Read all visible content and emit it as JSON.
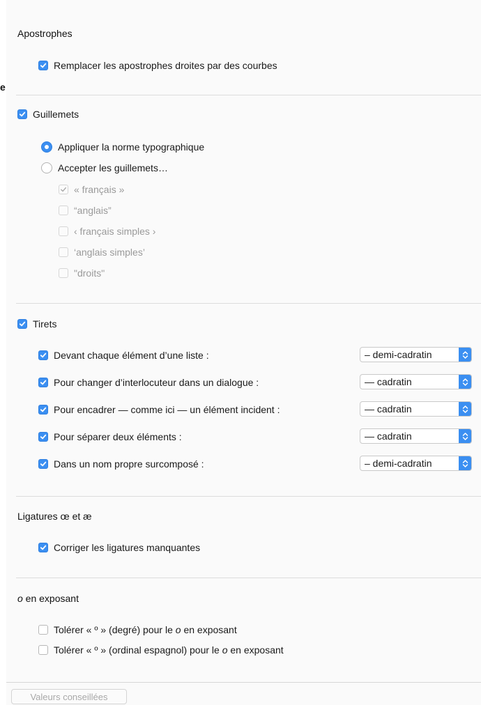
{
  "stray_text": "e",
  "apostrophes": {
    "title": "Apostrophes",
    "option": {
      "label": "Remplacer les apostrophes droites par des courbes",
      "checked": true
    }
  },
  "guillemets": {
    "title": "Guillemets",
    "checked": true,
    "radio_typo": {
      "label": "Appliquer la norme typographique",
      "selected": true
    },
    "radio_accept": {
      "label": "Accepter les guillemets…",
      "selected": false
    },
    "types": [
      {
        "label": "« français »",
        "checked": true
      },
      {
        "label": "“anglais”",
        "checked": false
      },
      {
        "label": "‹ français simples ›",
        "checked": false
      },
      {
        "label": "‘anglais simples’",
        "checked": false
      },
      {
        "label": "\"droits\"",
        "checked": false
      }
    ]
  },
  "tirets": {
    "title": "Tirets",
    "checked": true,
    "rows": [
      {
        "label": "Devant chaque élément d’une liste :",
        "value": "– demi-cadratin",
        "checked": true
      },
      {
        "label": "Pour changer d’interlocuteur dans un dialogue :",
        "value": "— cadratin",
        "checked": true
      },
      {
        "label": "Pour encadrer — comme ici — un élément incident :",
        "value": "— cadratin",
        "checked": true
      },
      {
        "label": "Pour séparer deux éléments :",
        "value": "— cadratin",
        "checked": true
      },
      {
        "label": "Dans un nom propre surcomposé :",
        "value": "– demi-cadratin",
        "checked": true
      }
    ]
  },
  "ligatures": {
    "title": "Ligatures œ et æ",
    "option": {
      "label": "Corriger les ligatures manquantes",
      "checked": true
    }
  },
  "exposant": {
    "title_letter": "o",
    "title_rest": " en exposant",
    "opt1": {
      "prefix": "Tolérer « º » (degré) pour le ",
      "letter": "o",
      "suffix": " en exposant",
      "checked": false
    },
    "opt2": {
      "prefix": "Tolérer « º » (ordinal espagnol) pour le ",
      "letter": "o",
      "suffix": " en exposant",
      "checked": false
    }
  },
  "footer": {
    "button_label": "Valeurs conseillées"
  },
  "colors": {
    "accent": "#3b8ff1",
    "panel": "#fafafa",
    "disabled_text": "#9a9a9a"
  }
}
